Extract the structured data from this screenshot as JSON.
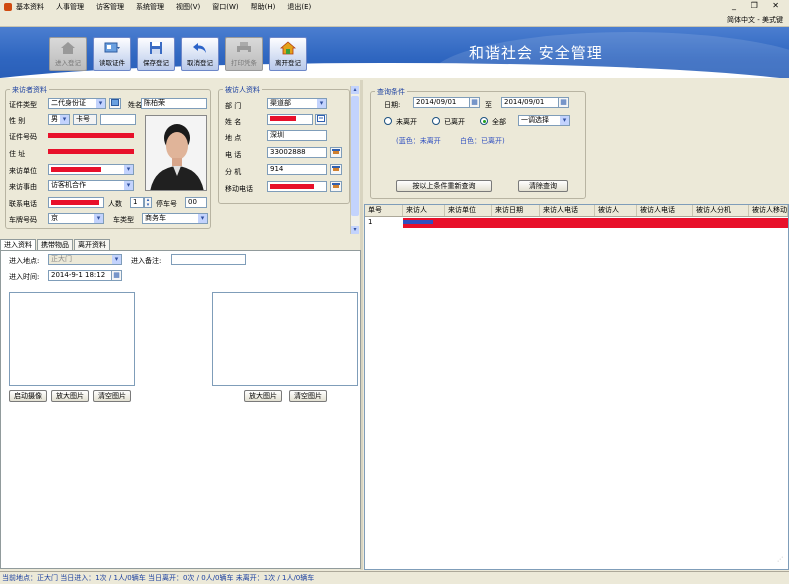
{
  "menu": [
    "基本资料",
    "人事管理",
    "访客管理",
    "系统管理",
    "视图(V)",
    "窗口(W)",
    "帮助(H)",
    "退出(E)"
  ],
  "window_controls": "_ ❐ ✕",
  "language": "简体中文 - 美式键",
  "banner": {
    "slogan": "和谐社会  安全管理"
  },
  "toolbar": {
    "enter": "进入登记",
    "read_card": "读取证件",
    "save": "保存登记",
    "cancel": "取消登记",
    "print": "打印凭条",
    "leave": "离开登记"
  },
  "visitor": {
    "legend": "来访者资料",
    "id_type_label": "证件类型",
    "id_type": "二代身份证",
    "name_label": "姓名",
    "name": "陈柏荣",
    "gender_label": "性    别",
    "gender": "男",
    "card_label": "卡号",
    "id_no_label": "证件号码",
    "address_label": "住    址",
    "unit_label": "来访单位",
    "reason_label": "来访事由",
    "reason": "访客机合作",
    "phone_label": "联系电话",
    "count_label": "人数",
    "count": "1",
    "parking_label": "停车号",
    "parking": "00",
    "plate_label": "车牌号码",
    "plate": "京",
    "vehicle_type_label": "车类型",
    "vehicle_type": "商务车"
  },
  "host": {
    "legend": "被访人资料",
    "dept_label": "部    门",
    "dept": "渠道部",
    "name_label": "姓    名",
    "location_label": "地    点",
    "location": "深圳",
    "phone_label": "电    话",
    "phone": "33002888",
    "ext_label": "分    机",
    "ext": "914",
    "mobile_label": "移动电话"
  },
  "query": {
    "legend": "查询条件",
    "date_label": "日期:",
    "date_from": "2014/09/01",
    "to_label": "至",
    "date_to": "2014/09/01",
    "radio_not_left": "未离开",
    "radio_left": "已离开",
    "radio_all": "全部",
    "filter": "一调选择",
    "color_note_blue": "(蓝色：未离开",
    "color_note_white": "白色：已离开)",
    "requery_button": "按以上条件重新查询",
    "clear_button": "清除查询"
  },
  "tabs": [
    "进入资料",
    "携带物品",
    "离开资料"
  ],
  "entry": {
    "location_label": "进入地点:",
    "location": "正大门",
    "remark_label": "进入备注:",
    "time_label": "进入时间:",
    "time": "2014-9-1  18:12",
    "start_camera": "启动摄像",
    "enlarge_left": "放大图片",
    "clear_left": "清空图片",
    "enlarge_right": "放大图片",
    "clear_right": "清空图片"
  },
  "grid": {
    "columns": [
      "单号",
      "来访人",
      "来访单位",
      "来访日期",
      "来访人电话",
      "被访人",
      "被访人电话",
      "被访人分机",
      "被访人移动"
    ],
    "rows": [
      [
        "1",
        "",
        "",
        "",
        "",
        "",
        "",
        "",
        ""
      ]
    ]
  },
  "status": "当前地点：正大门  当日进入：1次 / 1人/0辆车  当日离开：0次 / 0人/0辆车  未离开：1次 / 1人/0辆车"
}
